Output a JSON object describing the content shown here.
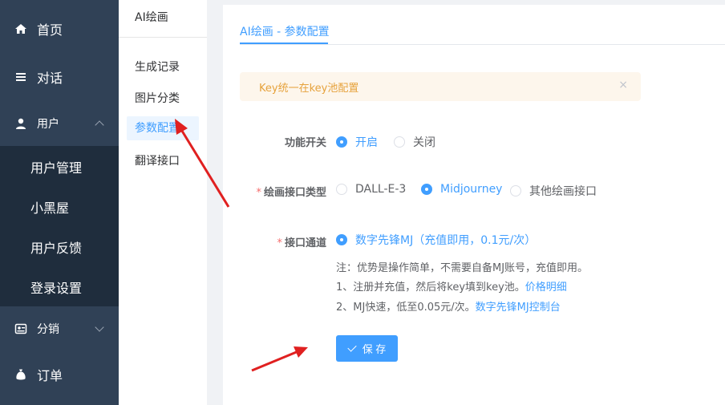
{
  "sidebar": {
    "items": [
      {
        "label": "首页",
        "icon": "home-icon"
      },
      {
        "label": "对话",
        "icon": "menu-icon"
      },
      {
        "label": "用户",
        "icon": "user-icon"
      },
      {
        "label": "分销",
        "icon": "distribution-icon"
      },
      {
        "label": "订单",
        "icon": "money-bag-icon"
      }
    ],
    "user_submenu": [
      "用户管理",
      "小黑屋",
      "用户反馈",
      "登录设置"
    ]
  },
  "secondary_nav": {
    "title": "AI绘画",
    "items": [
      "生成记录",
      "图片分类",
      "参数配置",
      "翻译接口"
    ],
    "active": "参数配置"
  },
  "main": {
    "tab": "AI绘画 - 参数配置",
    "alert": "Key统一在key池配置",
    "close_glyph": "×",
    "feature_switch": {
      "label": "功能开关",
      "options": [
        "开启",
        "关闭"
      ],
      "selected": "开启"
    },
    "draw_api_type": {
      "required_mark": "*",
      "label": "绘画接口类型",
      "options": [
        "DALL-E-3",
        "Midjourney",
        "其他绘画接口"
      ],
      "selected": "Midjourney"
    },
    "api_channel": {
      "required_mark": "*",
      "label": "接口通道",
      "option": "数字先锋MJ（充值即用，0.1元/次）",
      "note1": "注：优势是操作简单，不需要自备MJ账号，充值即用。",
      "note2_text": "1、注册并充值，然后将key填到key池。",
      "note2_link": "价格明细",
      "note3_text": "2、MJ快速，低至0.05元/次。",
      "note3_link": "数字先锋MJ控制台"
    },
    "save_label": "保 存"
  },
  "colors": {
    "accent": "#409eff",
    "sidebar_bg": "#304156",
    "submenu_bg": "#1f2d3d",
    "annotation_arrow": "#e02020"
  }
}
